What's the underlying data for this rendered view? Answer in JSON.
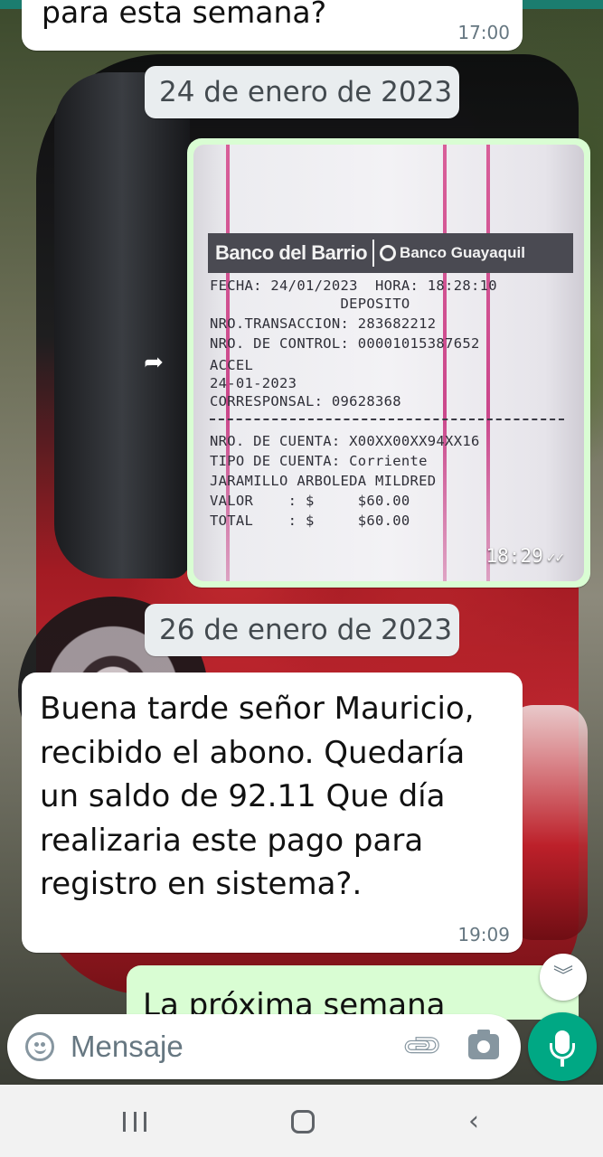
{
  "chat": {
    "prev_message": {
      "text": "para esta semana?",
      "time": "17:00"
    },
    "date_1": "24 de enero de 2023",
    "receipt": {
      "bank_name": "Banco del Barrio",
      "bank_partner": "Banco Guayaquil",
      "line_fecha": "FECHA: 24/01/2023  HORA: 18:28:10",
      "line_tipo": "DEPOSITO",
      "line_transaccion": "NRO.TRANSACCION: 283682212",
      "line_control": "NRO. DE CONTROL: 00001015387652",
      "line_agencia": "ACCEL",
      "line_fecha2": "24-01-2023",
      "line_corresponsal": "CORRESPONSAL: 09628368",
      "line_cuenta": "NRO. DE CUENTA: X00XX00XX94XX16",
      "line_tipo_cuenta": "TIPO DE CUENTA: Corriente",
      "line_titular": "JARAMILLO ARBOLEDA MILDRED",
      "line_valor": "VALOR    : $     $60.00",
      "line_total": "TOTAL    : $     $60.00",
      "time": "18:29",
      "status": "read"
    },
    "date_2": "26 de enero de 2023",
    "incoming_message": {
      "text": "Buena tarde señor Mauricio, recibido el abono. Quedaría un saldo de 92.11 Que día realizaria este pago para registro en sistema?.",
      "time": "19:09"
    },
    "outgoing_partial": {
      "text": "La próxima semana"
    }
  },
  "composer": {
    "placeholder": "Mensaje"
  },
  "icons": {
    "emoji": "smiley-icon",
    "attach": "paperclip-icon",
    "camera": "camera-icon",
    "mic": "microphone-icon",
    "forward": "forward-icon",
    "scroll": "double-chevron-down-icon"
  },
  "colors": {
    "outgoing_bubble": "#d9fdd3",
    "incoming_bubble": "#ffffff",
    "accent": "#00a884",
    "date_chip": "#e9edef"
  }
}
